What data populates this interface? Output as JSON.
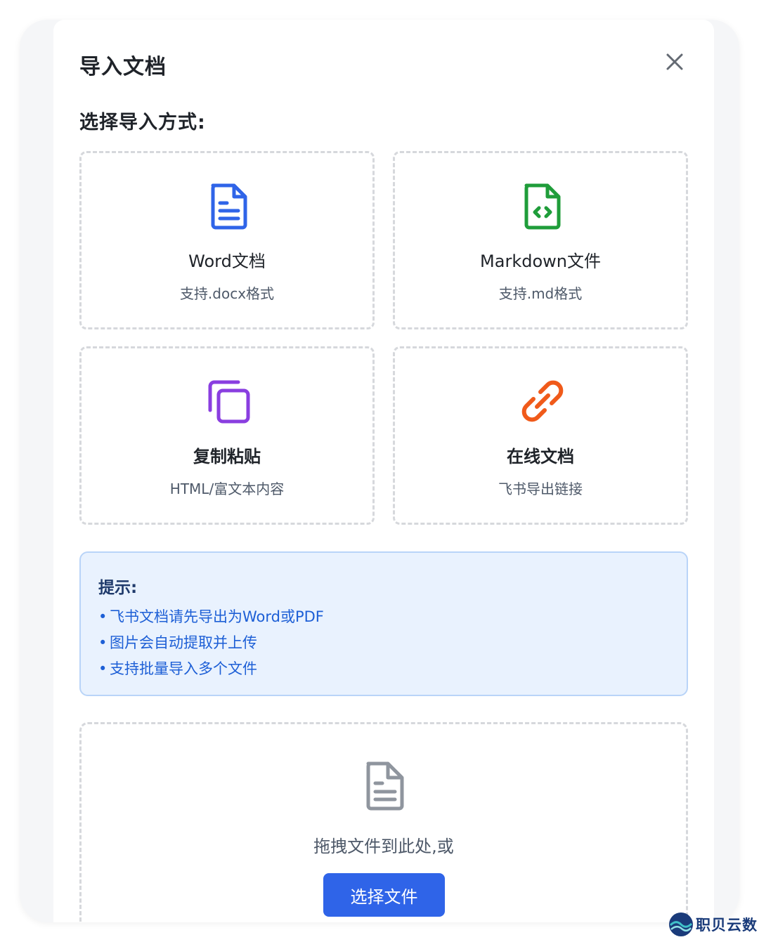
{
  "dialog": {
    "title": "导入文档",
    "subtitle": "选择导入方式:"
  },
  "options": [
    {
      "title": "Word文档",
      "desc": "支持.docx格式",
      "icon": "document-icon",
      "color": "#2f64e8"
    },
    {
      "title": "Markdown文件",
      "desc": "支持.md格式",
      "icon": "code-file-icon",
      "color": "#1f9d3a"
    },
    {
      "title": "复制粘贴",
      "desc": "HTML/富文本内容",
      "icon": "copy-icon",
      "color": "#8a3ee0"
    },
    {
      "title": "在线文档",
      "desc": "飞书导出链接",
      "icon": "link-icon",
      "color": "#f05a1a"
    }
  ],
  "tips": {
    "title": "提示:",
    "bullet": "•",
    "items": [
      "飞书文档请先导出为Word或PDF",
      "图片会自动提取并上传",
      "支持批量导入多个文件"
    ]
  },
  "upload": {
    "drop_text": "拖拽文件到此处,或",
    "button_label": "选择文件",
    "icon": "file-icon"
  },
  "watermark": {
    "text": "职贝云数"
  },
  "colors": {
    "primary": "#2f64e8",
    "tip_bg": "#e9f2fe",
    "tip_text": "#1d5fd6"
  }
}
